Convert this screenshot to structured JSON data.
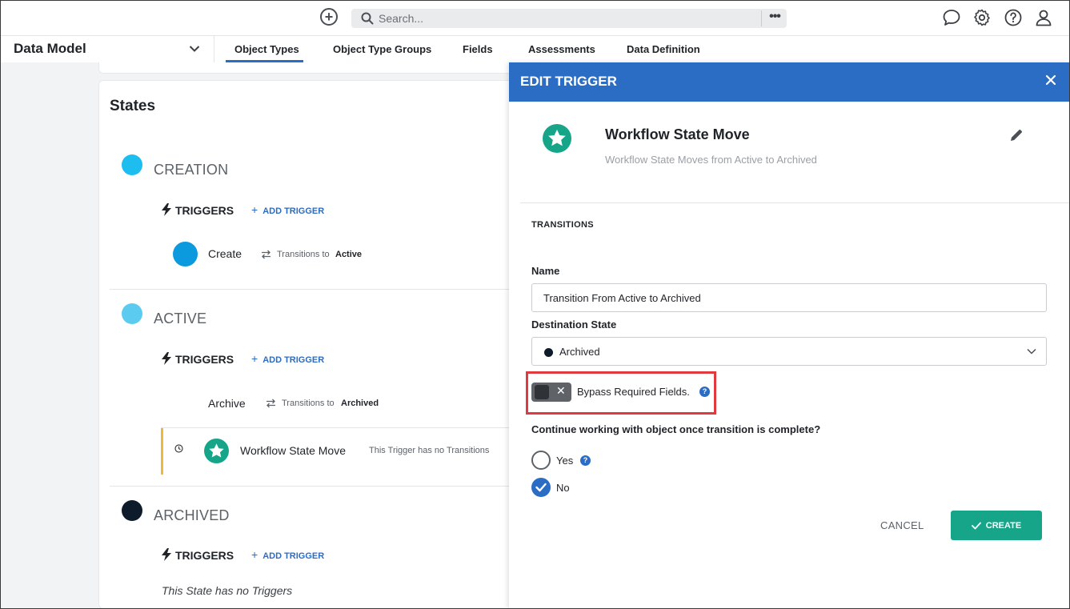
{
  "topbar": {
    "search_placeholder": "Search...",
    "more_label": "•••"
  },
  "nav": {
    "module_title": "Data Model",
    "tabs": [
      {
        "label": "Object Types",
        "active": true
      },
      {
        "label": "Object Type Groups"
      },
      {
        "label": "Fields"
      },
      {
        "label": "Assessments"
      },
      {
        "label": "Data Definition"
      }
    ]
  },
  "states": {
    "title": "States",
    "triggers_label": "TRIGGERS",
    "add_trigger_label": "ADD TRIGGER",
    "transitions_to_label": "Transitions to",
    "items": [
      {
        "name": "CREATION",
        "color": "#1ebdf0",
        "trigger": {
          "name": "Create",
          "target": "Active"
        }
      },
      {
        "name": "ACTIVE",
        "color": "#5ccbf0",
        "trigger": {
          "name": "Archive",
          "target": "Archived"
        },
        "workflow_trigger": {
          "name": "Workflow State Move",
          "note": "This Trigger has no Transitions"
        }
      },
      {
        "name": "ARCHIVED",
        "color": "#0d1b2a",
        "empty_note": "This State has no Triggers"
      }
    ]
  },
  "panel": {
    "header": "EDIT TRIGGER",
    "trigger_title": "Workflow State Move",
    "trigger_subtitle": "Workflow State Moves from Active to Archived",
    "section_title": "TRANSITIONS",
    "name_label": "Name",
    "name_value": "Transition From Active to Archived",
    "destination_label": "Destination State",
    "destination_value": "Archived",
    "bypass_label": "Bypass Required Fields.",
    "bypass_enabled": false,
    "continue_question": "Continue working with object once transition is complete?",
    "options": [
      {
        "label": "Yes",
        "checked": false
      },
      {
        "label": "No",
        "checked": true
      }
    ],
    "cancel_label": "CANCEL",
    "create_label": "CREATE",
    "help_glyph": "?"
  },
  "colors": {
    "accent": "#2b6cc4",
    "create_button": "#17a589",
    "workflow_icon": "#17a589",
    "highlight": "#e0393e",
    "trigger_bar": "#f0b838"
  },
  "icons": {
    "add": "plus-circle-icon",
    "search": "search-icon",
    "chat": "chat-icon",
    "settings": "gear-icon",
    "help": "help-icon",
    "user": "user-icon"
  }
}
